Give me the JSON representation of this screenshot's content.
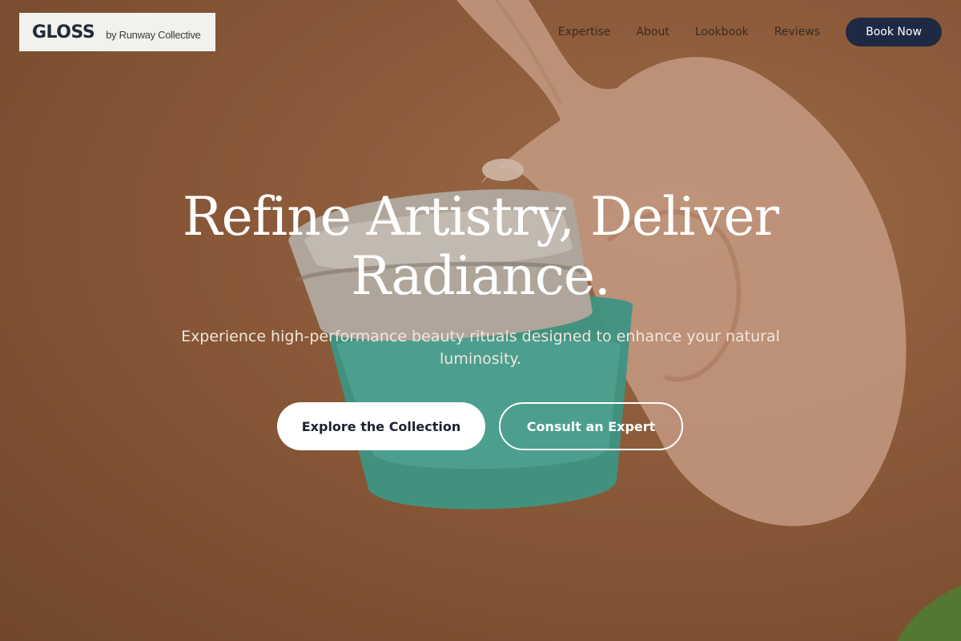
{
  "brand": {
    "name": "GLOSS",
    "subtitle": "by Runway Collective"
  },
  "nav": {
    "links": [
      "Expertise",
      "About",
      "Lookbook",
      "Reviews"
    ],
    "cta_label": "Book Now"
  },
  "hero": {
    "headline_line1": "Refine Artistry, Deliver",
    "headline_line2": "Radiance.",
    "subtext": "Experience high-performance beauty rituals designed to enhance your natural luminosity.",
    "primary_button": "Explore the Collection",
    "secondary_button": "Consult an Expert"
  },
  "colors": {
    "background": "#9a6540",
    "brand_box": "#f3f1ee",
    "cta_navy": "#1e2a44",
    "jar_teal": "#3fae9c",
    "cap_silver": "#c9c2b8"
  },
  "icons": {
    "background_image": "hand-holding-cream-jar"
  }
}
